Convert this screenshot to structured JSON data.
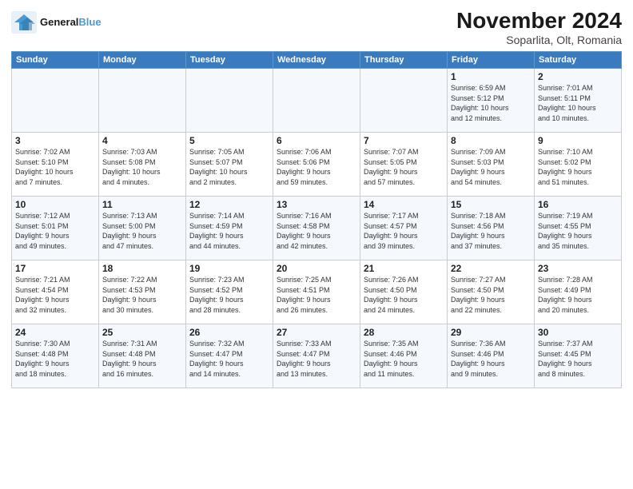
{
  "logo": {
    "line1": "General",
    "line2": "Blue"
  },
  "title": "November 2024",
  "subtitle": "Soparlita, Olt, Romania",
  "days_header": [
    "Sunday",
    "Monday",
    "Tuesday",
    "Wednesday",
    "Thursday",
    "Friday",
    "Saturday"
  ],
  "weeks": [
    [
      {
        "day": "",
        "detail": ""
      },
      {
        "day": "",
        "detail": ""
      },
      {
        "day": "",
        "detail": ""
      },
      {
        "day": "",
        "detail": ""
      },
      {
        "day": "",
        "detail": ""
      },
      {
        "day": "1",
        "detail": "Sunrise: 6:59 AM\nSunset: 5:12 PM\nDaylight: 10 hours\nand 12 minutes."
      },
      {
        "day": "2",
        "detail": "Sunrise: 7:01 AM\nSunset: 5:11 PM\nDaylight: 10 hours\nand 10 minutes."
      }
    ],
    [
      {
        "day": "3",
        "detail": "Sunrise: 7:02 AM\nSunset: 5:10 PM\nDaylight: 10 hours\nand 7 minutes."
      },
      {
        "day": "4",
        "detail": "Sunrise: 7:03 AM\nSunset: 5:08 PM\nDaylight: 10 hours\nand 4 minutes."
      },
      {
        "day": "5",
        "detail": "Sunrise: 7:05 AM\nSunset: 5:07 PM\nDaylight: 10 hours\nand 2 minutes."
      },
      {
        "day": "6",
        "detail": "Sunrise: 7:06 AM\nSunset: 5:06 PM\nDaylight: 9 hours\nand 59 minutes."
      },
      {
        "day": "7",
        "detail": "Sunrise: 7:07 AM\nSunset: 5:05 PM\nDaylight: 9 hours\nand 57 minutes."
      },
      {
        "day": "8",
        "detail": "Sunrise: 7:09 AM\nSunset: 5:03 PM\nDaylight: 9 hours\nand 54 minutes."
      },
      {
        "day": "9",
        "detail": "Sunrise: 7:10 AM\nSunset: 5:02 PM\nDaylight: 9 hours\nand 51 minutes."
      }
    ],
    [
      {
        "day": "10",
        "detail": "Sunrise: 7:12 AM\nSunset: 5:01 PM\nDaylight: 9 hours\nand 49 minutes."
      },
      {
        "day": "11",
        "detail": "Sunrise: 7:13 AM\nSunset: 5:00 PM\nDaylight: 9 hours\nand 47 minutes."
      },
      {
        "day": "12",
        "detail": "Sunrise: 7:14 AM\nSunset: 4:59 PM\nDaylight: 9 hours\nand 44 minutes."
      },
      {
        "day": "13",
        "detail": "Sunrise: 7:16 AM\nSunset: 4:58 PM\nDaylight: 9 hours\nand 42 minutes."
      },
      {
        "day": "14",
        "detail": "Sunrise: 7:17 AM\nSunset: 4:57 PM\nDaylight: 9 hours\nand 39 minutes."
      },
      {
        "day": "15",
        "detail": "Sunrise: 7:18 AM\nSunset: 4:56 PM\nDaylight: 9 hours\nand 37 minutes."
      },
      {
        "day": "16",
        "detail": "Sunrise: 7:19 AM\nSunset: 4:55 PM\nDaylight: 9 hours\nand 35 minutes."
      }
    ],
    [
      {
        "day": "17",
        "detail": "Sunrise: 7:21 AM\nSunset: 4:54 PM\nDaylight: 9 hours\nand 32 minutes."
      },
      {
        "day": "18",
        "detail": "Sunrise: 7:22 AM\nSunset: 4:53 PM\nDaylight: 9 hours\nand 30 minutes."
      },
      {
        "day": "19",
        "detail": "Sunrise: 7:23 AM\nSunset: 4:52 PM\nDaylight: 9 hours\nand 28 minutes."
      },
      {
        "day": "20",
        "detail": "Sunrise: 7:25 AM\nSunset: 4:51 PM\nDaylight: 9 hours\nand 26 minutes."
      },
      {
        "day": "21",
        "detail": "Sunrise: 7:26 AM\nSunset: 4:50 PM\nDaylight: 9 hours\nand 24 minutes."
      },
      {
        "day": "22",
        "detail": "Sunrise: 7:27 AM\nSunset: 4:50 PM\nDaylight: 9 hours\nand 22 minutes."
      },
      {
        "day": "23",
        "detail": "Sunrise: 7:28 AM\nSunset: 4:49 PM\nDaylight: 9 hours\nand 20 minutes."
      }
    ],
    [
      {
        "day": "24",
        "detail": "Sunrise: 7:30 AM\nSunset: 4:48 PM\nDaylight: 9 hours\nand 18 minutes."
      },
      {
        "day": "25",
        "detail": "Sunrise: 7:31 AM\nSunset: 4:48 PM\nDaylight: 9 hours\nand 16 minutes."
      },
      {
        "day": "26",
        "detail": "Sunrise: 7:32 AM\nSunset: 4:47 PM\nDaylight: 9 hours\nand 14 minutes."
      },
      {
        "day": "27",
        "detail": "Sunrise: 7:33 AM\nSunset: 4:47 PM\nDaylight: 9 hours\nand 13 minutes."
      },
      {
        "day": "28",
        "detail": "Sunrise: 7:35 AM\nSunset: 4:46 PM\nDaylight: 9 hours\nand 11 minutes."
      },
      {
        "day": "29",
        "detail": "Sunrise: 7:36 AM\nSunset: 4:46 PM\nDaylight: 9 hours\nand 9 minutes."
      },
      {
        "day": "30",
        "detail": "Sunrise: 7:37 AM\nSunset: 4:45 PM\nDaylight: 9 hours\nand 8 minutes."
      }
    ]
  ]
}
